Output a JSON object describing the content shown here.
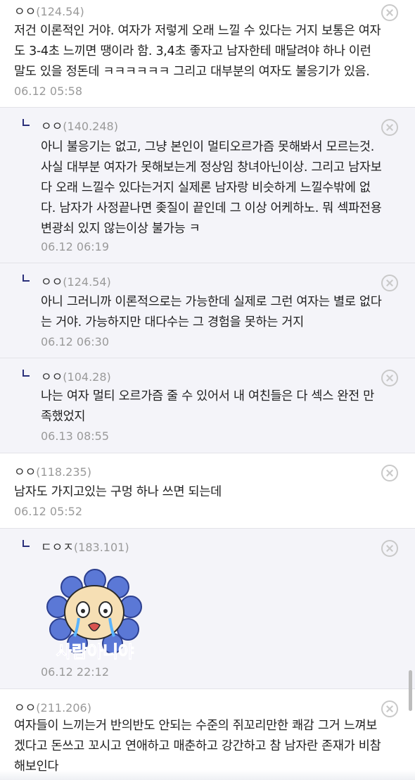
{
  "comments": [
    {
      "nick": "ㅇㅇ",
      "ip": "(124.54)",
      "lines": [
        "저건 이론적인 거야. 여자가 저렇게 오래 느낄 수 있다는 거지 보통은 여자",
        "도 3-4초 느끼면 땡이라 함. 3,4초 좋자고 남자한테 매달려야 하나 이런",
        "말도 있을 정돈데 ㅋㅋㅋㅋㅋㅋ 그리고 대부분의 여자도 불응기가 있음."
      ],
      "date": "06.12 05:58"
    },
    {
      "nick": "ㅇㅇ",
      "ip": "(140.248)",
      "lines": [
        "아니 불응기는 없고, 그냥 본인이 멀티오르가즘 못해봐서 모르는것.",
        "사실 대부분 여자가 못해보는게 정상임 창녀아닌이상. 그리고 남자보",
        "다 오래 느낄수 있다는거지 실제론 남자랑 비슷하게 느낄수밖에 없",
        "다. 남자가 사정끝나면 좆질이 끝인데 그 이상 어케하노. 뭐 섹파전용",
        "변광쇠 있지 않는이상 불가능 ㅋ"
      ],
      "date": "06.12 06:19"
    },
    {
      "nick": "ㅇㅇ",
      "ip": "(124.54)",
      "lines": [
        "아니 그러니까 이론적으로는 가능한데 실제로 그런 여자는 별로 없다",
        "는 거야. 가능하지만 대다수는 그 경험을 못하는 거지"
      ],
      "date": "06.12 06:30"
    },
    {
      "nick": "ㅇㅇ",
      "ip": "(104.28)",
      "lines": [
        "나는 여자 멀티 오르가즘 줄 수 있어서 내 여친들은 다 섹스 완전 만",
        "족했었지"
      ],
      "date": "06.13 08:55"
    },
    {
      "nick": "ㅇㅇ",
      "ip": "(118.235)",
      "lines": [
        "남자도 가지고있는 구멍 하나 쓰면 되는데"
      ],
      "date": "06.12 05:52"
    },
    {
      "nick": "ㄷㅇㅈ",
      "ip": "(183.101)",
      "sticker_text": "사람아니야",
      "date": "06.12 22:12"
    },
    {
      "nick": "ㅇㅇ",
      "ip": "(211.206)",
      "lines": [
        "여자들이 느끼는거 반의반도 안되는 수준의 쥐꼬리만한 쾌감 그거 느껴보",
        "겠다고 돈쓰고 꼬시고 연애하고 매춘하고 강간하고 참 남자란 존재가 비참",
        "해보인다"
      ]
    }
  ],
  "colors": {
    "reply_background": "#f4f4f9",
    "reply_mark": "#2a2f7a",
    "sticker_text": "#6a4fd8",
    "sticker_petals": "#5b78d6"
  },
  "icons": {
    "delete": "close-circle-icon",
    "reply": "reply-arrow-icon"
  }
}
